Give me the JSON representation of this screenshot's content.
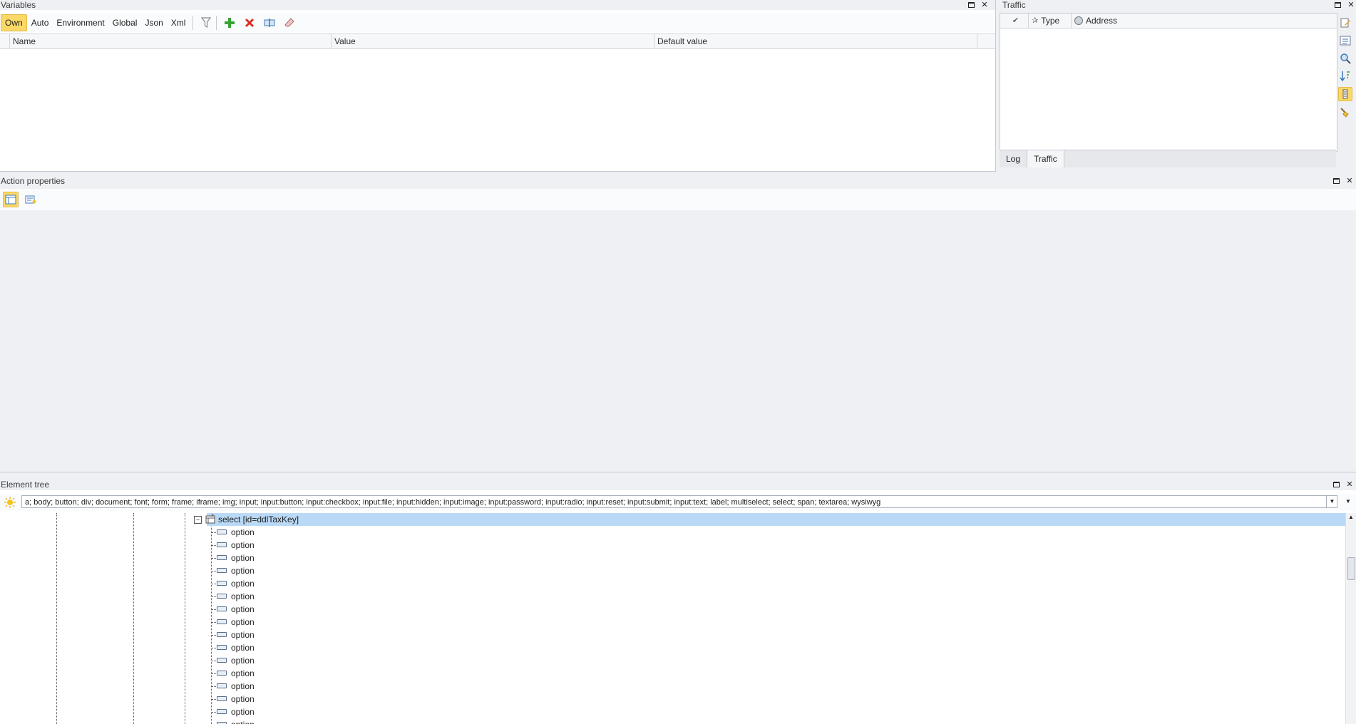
{
  "variables": {
    "title": "Variables",
    "tabs": [
      "Own",
      "Auto",
      "Environment",
      "Global",
      "Json",
      "Xml"
    ],
    "columns": [
      "Name",
      "Value",
      "Default value"
    ]
  },
  "traffic": {
    "title": "Traffic",
    "columns": [
      "Type",
      "Address"
    ],
    "tabs": [
      "Log",
      "Traffic"
    ]
  },
  "action_properties": {
    "title": "Action properties"
  },
  "element_tree": {
    "title": "Element tree",
    "filter_value": "a; body; button; div; document; font; form; frame; iframe; img; input; input:button; input:checkbox; input:file; input:hidden; input:image; input:password; input:radio; input:reset; input:submit; input:text; label; multiselect; select; span; textarea; wysiwyg",
    "selected_node": "select [id=ddlTaxKey]",
    "child_nodes": [
      "option",
      "option",
      "option",
      "option",
      "option",
      "option",
      "option",
      "option",
      "option",
      "option",
      "option",
      "option",
      "option",
      "option",
      "option",
      "option"
    ]
  },
  "icons": {
    "close": "close-icon",
    "maximize": "maximize-icon",
    "filter": "filter-icon",
    "add": "add-icon",
    "delete": "delete-icon",
    "rename": "rename-icon",
    "clear": "eraser-icon"
  },
  "colors": {
    "accent_active": "#fbd966",
    "selection": "#b9d9f7",
    "panel_bg": "#eef0f4"
  }
}
